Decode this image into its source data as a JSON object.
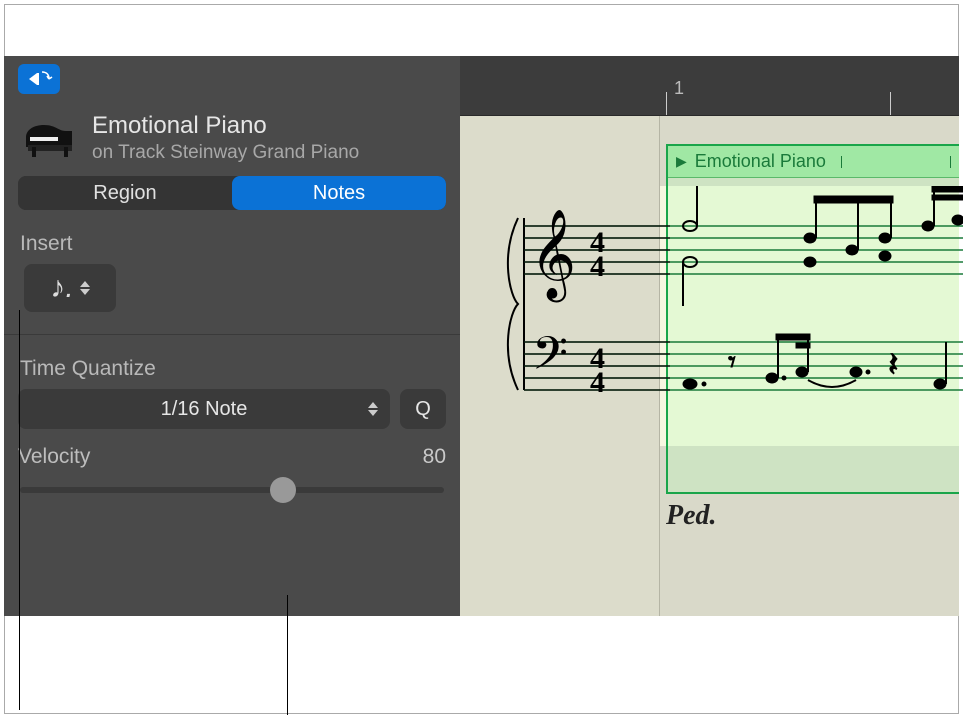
{
  "header": {
    "title": "Emotional Piano",
    "subtitle": "on Track Steinway Grand Piano"
  },
  "tabs": {
    "region": "Region",
    "notes": "Notes"
  },
  "insert": {
    "label": "Insert",
    "value_glyph": "♪."
  },
  "quantize": {
    "label": "Time Quantize",
    "value": "1/16 Note",
    "button": "Q"
  },
  "velocity": {
    "label": "Velocity",
    "value": "80",
    "slider_pct": 62
  },
  "ruler": {
    "position": "1"
  },
  "region": {
    "name": "Emotional Piano"
  },
  "pedal_mark": "Ped."
}
